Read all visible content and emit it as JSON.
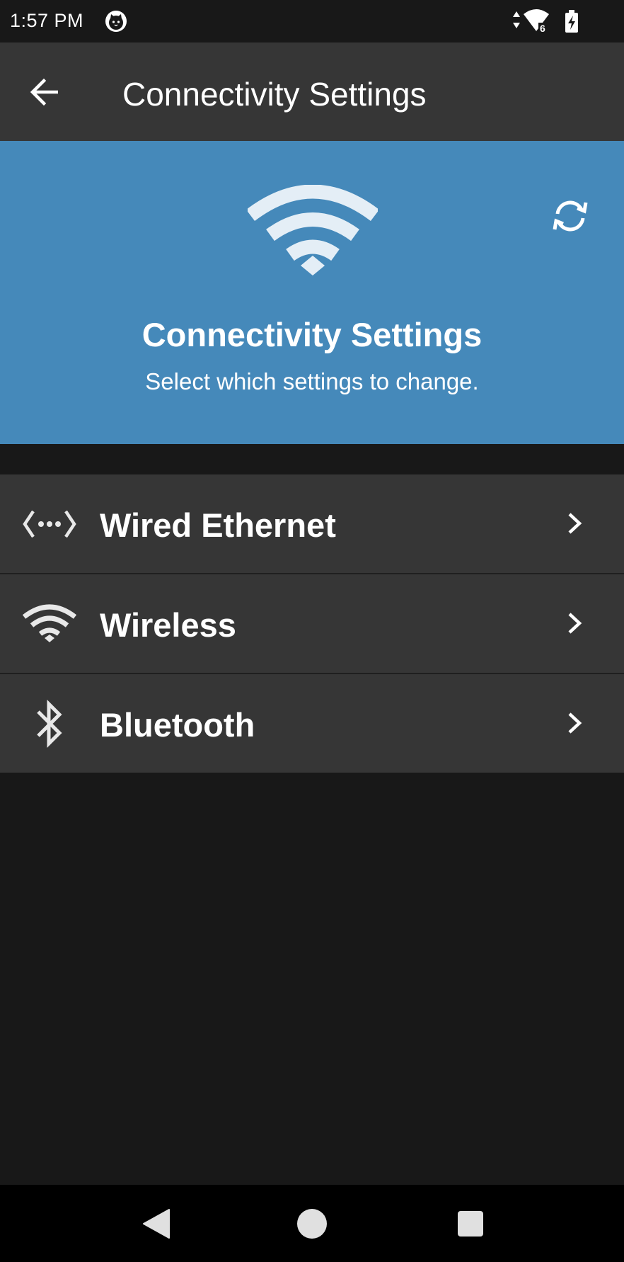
{
  "status_bar": {
    "time": "1:57 PM",
    "signal_badge": "6"
  },
  "app_bar": {
    "title": "Connectivity Settings"
  },
  "hero": {
    "title": "Connectivity Settings",
    "subtitle": "Select which settings to change."
  },
  "menu": {
    "items": [
      {
        "label": "Wired Ethernet",
        "icon": "ethernet-icon"
      },
      {
        "label": "Wireless",
        "icon": "wifi-icon"
      },
      {
        "label": "Bluetooth",
        "icon": "bluetooth-icon"
      }
    ]
  },
  "colors": {
    "hero_background": "#4589ba",
    "app_bar_background": "#363636",
    "list_item_background": "#363636",
    "page_background": "#181818",
    "nav_bar_background": "#000000"
  }
}
